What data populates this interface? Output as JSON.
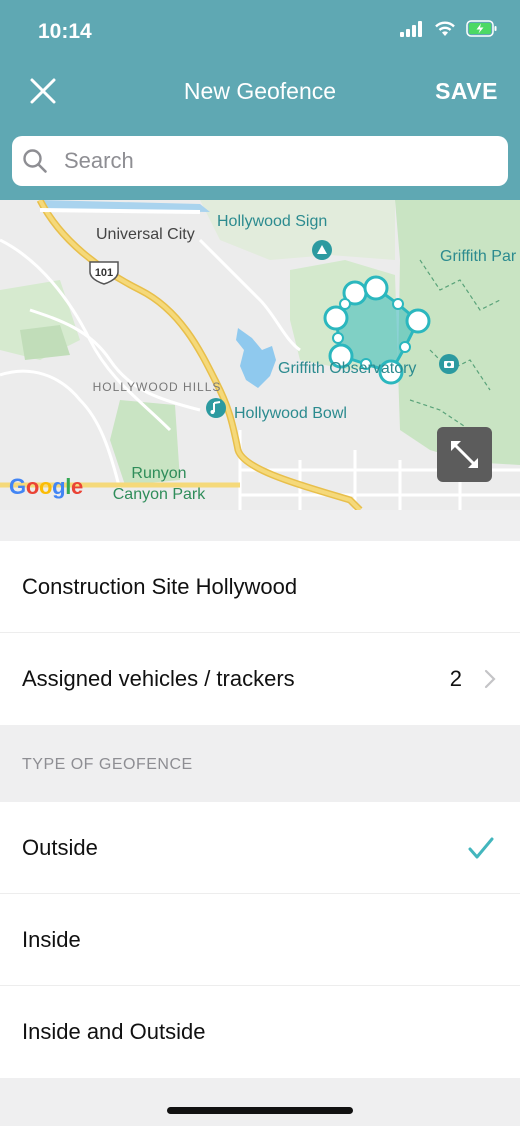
{
  "status_bar": {
    "time": "10:14",
    "icons": [
      "signal-icon",
      "wifi-icon",
      "battery-charging-icon"
    ]
  },
  "header": {
    "title": "New Geofence",
    "close_icon": "close-icon",
    "save_label": "SAVE"
  },
  "search": {
    "placeholder": "Search",
    "value": ""
  },
  "map": {
    "labels": {
      "universal_city": "Universal City",
      "hollywood_sign": "Hollywood Sign",
      "griffith_park": "Griffith Par",
      "hollywood_hills": "HOLLYWOOD HILLS",
      "griffith_observatory": "Griffith Observatory",
      "hollywood_bowl": "Hollywood Bowl",
      "runyon_canyon": "Runyon Canyon Park",
      "highway": "101"
    },
    "attribution": "Google",
    "expand_icon": "expand-icon",
    "colors": {
      "geofence": "#2bb7be",
      "water": "#8fc9ee",
      "park": "#c8e3c2",
      "road": "#f2cf5d"
    }
  },
  "details": {
    "name": "Construction Site Hollywood",
    "assigned_label": "Assigned vehicles / trackers",
    "assigned_count": "2"
  },
  "type_section": {
    "header": "TYPE OF GEOFENCE",
    "options": [
      {
        "label": "Outside",
        "selected": true
      },
      {
        "label": "Inside",
        "selected": false
      },
      {
        "label": "Inside and Outside",
        "selected": false
      }
    ]
  },
  "theme": {
    "accent": "#5fa8b3",
    "check": "#43b6bd"
  }
}
